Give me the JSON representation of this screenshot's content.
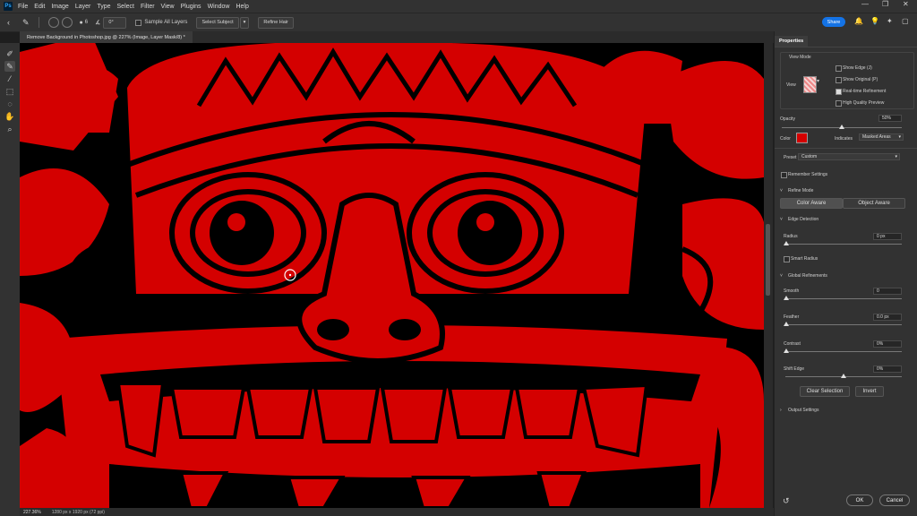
{
  "app": {
    "logo_text": "Ps"
  },
  "menu": [
    "File",
    "Edit",
    "Image",
    "Layer",
    "Type",
    "Select",
    "Filter",
    "View",
    "Plugins",
    "Window",
    "Help"
  ],
  "options_bar": {
    "size_value": "6",
    "angle_value": "0°",
    "sample_all_layers": "Sample All Layers",
    "select_subject": "Select Subject",
    "refine_hair": "Refine Hair",
    "share": "Share"
  },
  "document": {
    "tab_title": "Remove Background in Photoshop.jpg @ 227% (Image, Layer Mask/8) *"
  },
  "status": {
    "zoom": "227.36%",
    "doc_info": "1280 px x 1920 px (72 ppi)"
  },
  "properties": {
    "tab": "Properties",
    "view_mode": "View Mode",
    "view": "View",
    "show_edge": "Show Edge (J)",
    "show_original": "Show Original (P)",
    "realtime_refinement": "Real-time Refinement",
    "high_quality_preview": "High Quality Preview",
    "opacity_label": "Opacity",
    "opacity_value": "50%",
    "opacity_level": 0.5,
    "color_label": "Color",
    "overlay_color": "#d40000",
    "indicates_label": "Indicates",
    "indicates_value": "Masked Areas",
    "preset_label": "Preset",
    "preset_value": "Custom",
    "remember_settings": "Remember Settings",
    "refine_mode": "Refine Mode",
    "color_aware": "Color Aware",
    "object_aware": "Object Aware",
    "edge_detection": "Edge Detection",
    "radius_label": "Radius",
    "radius_value": "0 px",
    "smart_radius": "Smart Radius",
    "global_refinements": "Global Refinements",
    "smooth_label": "Smooth",
    "smooth_value": "0",
    "feather_label": "Feather",
    "feather_value": "0.0 px",
    "contrast_label": "Contrast",
    "contrast_value": "0%",
    "shift_edge_label": "Shift Edge",
    "shift_edge_value": "0%",
    "clear_selection": "Clear Selection",
    "invert": "Invert",
    "output_settings": "Output Settings",
    "ok": "OK",
    "cancel": "Cancel"
  },
  "colors": {
    "accent": "#1473e6",
    "mask_red": "#d40000"
  }
}
